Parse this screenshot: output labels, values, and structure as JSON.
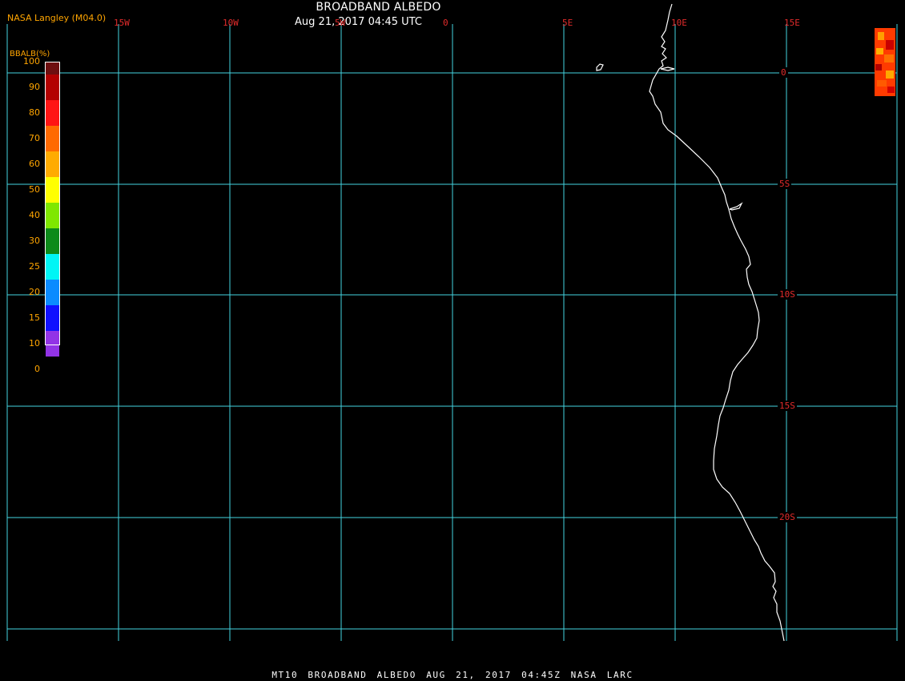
{
  "header": {
    "credit": "NASA Langley (M04.0)",
    "title": "BROADBAND ALBEDO",
    "timestamp": "Aug 21, 2017 04:45 UTC"
  },
  "footer": {
    "caption": "MT10  BROADBAND ALBEDO   AUG 21, 2017 04:45Z   NASA LARC"
  },
  "colorbar": {
    "title": "BBALB(%)",
    "labels": [
      "100",
      "90",
      "80",
      "70",
      "60",
      "50",
      "40",
      "30",
      "25",
      "20",
      "15",
      "10",
      "0"
    ],
    "colors": [
      "#6e0f10",
      "#b30000",
      "#ff1414",
      "#ff6a00",
      "#ffab00",
      "#ffff00",
      "#7fe700",
      "#0d8a1a",
      "#00f5f5",
      "#0b8bff",
      "#1010ff",
      "#9233e6"
    ]
  },
  "map": {
    "lon_labels": [
      "15W",
      "10W",
      "5W",
      "0",
      "5E",
      "10E",
      "15E"
    ],
    "lat_labels": [
      "0",
      "5S",
      "10S",
      "15S",
      "20S"
    ],
    "grid_color": "#44d3e0",
    "coast_color": "#ffffff",
    "label_color": "#e22b2b"
  }
}
